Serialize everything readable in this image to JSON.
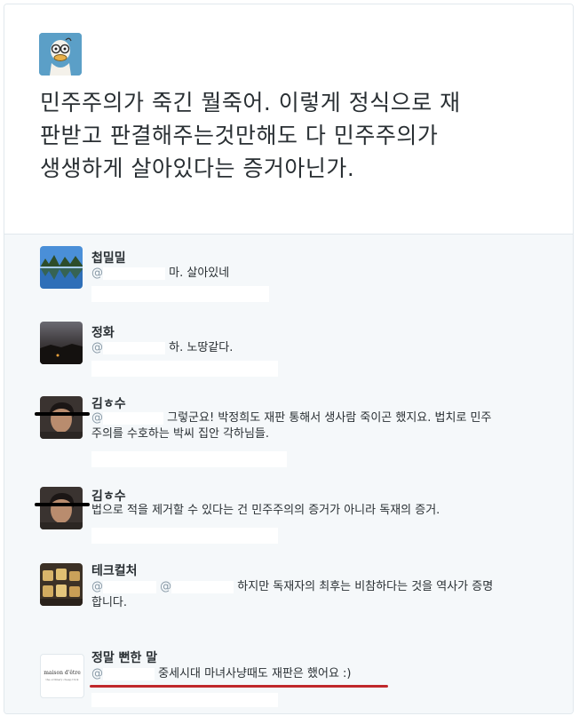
{
  "main_tweet": {
    "avatar_icon": "cartoon-duck-avatar-icon",
    "lines": [
      "민주주의가 죽긴 뭘죽어. 이렇게 정식으로 재",
      "판받고 판결해주는것만해도 다 민주주의가",
      "생생하게 살아있다는 증거아닌가."
    ]
  },
  "replies": [
    {
      "name": "첩밀밀",
      "handle": "@",
      "text": "마. 살아있네",
      "avatar": "lake-landscape-avatar"
    },
    {
      "name": "정화",
      "handle": "@",
      "text": "하. 노땅같다.",
      "avatar": "dark-sunset-avatar"
    },
    {
      "name": "김ㅎ수",
      "handle": "@",
      "text_lines": [
        "그렇군요! 박정희도 재판 통해서 생사람 죽이곤 했지요. 법치로 민주",
        "주의를 수호하는 박씨 집안 각하님들."
      ],
      "avatar": "person-photo-avatar"
    },
    {
      "name": "김ㅎ수",
      "handle": "",
      "text": "법으로 적을 제거할 수 있다는 건 민주주의의 증거가 아니라 독재의 증거.",
      "avatar": "person-photo-avatar"
    },
    {
      "name": "테크컬처",
      "handle": "@",
      "handle2": "@",
      "text_lines": [
        "하지만 독재자의 최후는 비참하다는 것을 역사가 증명",
        "합니다."
      ],
      "avatar": "food-photo-avatar"
    },
    {
      "name": "정말 뻔한 말",
      "handle": "@",
      "text": "중세시대 마녀사냥때도 재판은 했어요 :)",
      "avatar_text": "maison d'être",
      "avatar_subtext": "the ordinary cheap trick"
    }
  ],
  "colors": {
    "reply_bg": "#f5f8fa",
    "border": "#e1e8ed",
    "handle": "#8899a6",
    "underline": "#c0282b"
  }
}
